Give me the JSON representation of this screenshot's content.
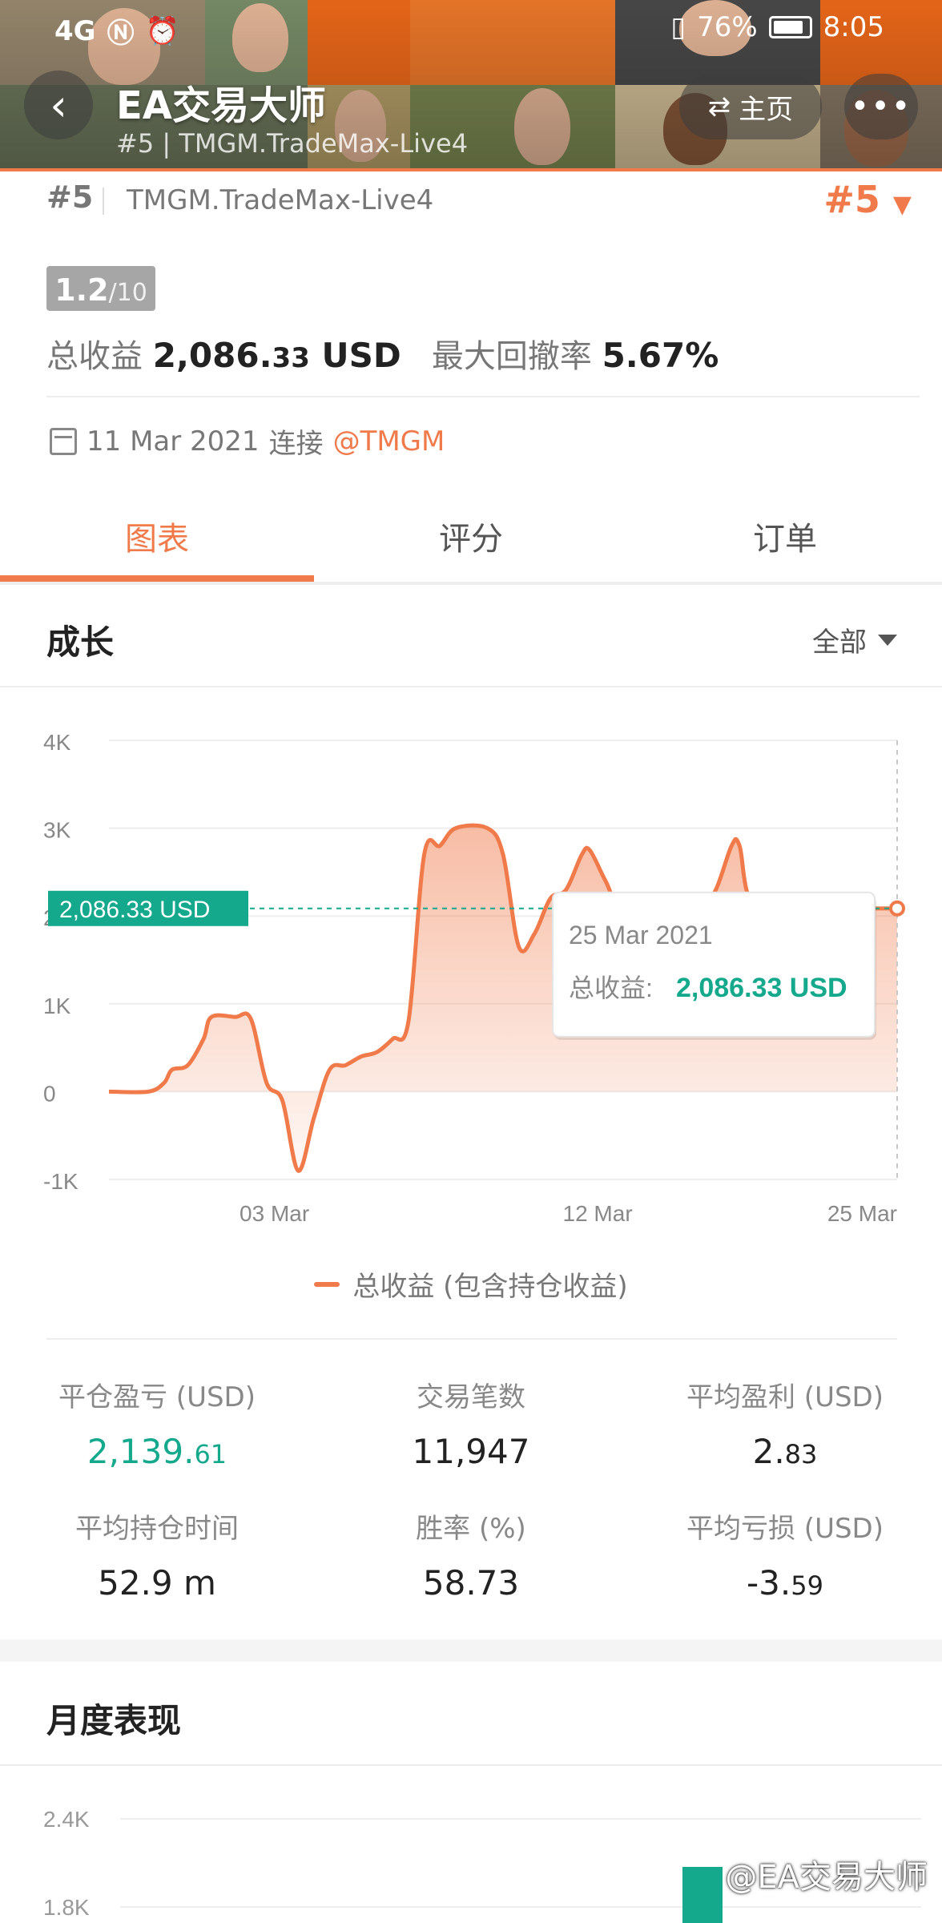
{
  "status_bar": {
    "signal": "4G",
    "battery_percent": "76%",
    "time": "8:05"
  },
  "header": {
    "title": "EA交易大师",
    "subtitle": "#5 | TMGM.TradeMax-Live4",
    "home_label": "主页",
    "more_icon": "ellipsis-icon",
    "back_icon": "chevron-left-icon"
  },
  "profile": {
    "rank_small": "#5",
    "server": "TMGM.TradeMax-Live4",
    "rank_big": "#5",
    "score": "1.2",
    "score_max": "/10",
    "total_profit_label": "总收益",
    "total_profit_main": "2,086.",
    "total_profit_dec": "33",
    "total_profit_unit": "USD",
    "drawdown_label": "最大回撤率",
    "drawdown_value": "5.67%",
    "connect_date": "11 Mar 2021",
    "connect_label": "连接",
    "connect_broker": "@TMGM"
  },
  "tabs": [
    {
      "label": "图表",
      "active": true
    },
    {
      "label": "评分",
      "active": false
    },
    {
      "label": "订单",
      "active": false
    }
  ],
  "growth": {
    "title": "成长",
    "filter_label": "全部",
    "current_value_label": "2,086.33 USD",
    "tooltip_date": "25 Mar 2021",
    "tooltip_label": "总收益:",
    "tooltip_value": "2,086.33 USD",
    "legend": "总收益 (包含持仓收益)"
  },
  "chart_data": {
    "type": "area",
    "x_tick_labels": [
      "03 Mar",
      "12 Mar",
      "25 Mar"
    ],
    "y_tick_labels": [
      "4K",
      "3K",
      "2K",
      "1K",
      "0",
      "-1K"
    ],
    "ylim": [
      -1000,
      4000
    ],
    "grid": true,
    "legend_placement": "bottom",
    "accent_color": "#f07a4a",
    "series": [
      {
        "name": "总收益 (包含持仓收益)",
        "points": [
          [
            0,
            0
          ],
          [
            0.05,
            0
          ],
          [
            0.07,
            100
          ],
          [
            0.08,
            250
          ],
          [
            0.1,
            300
          ],
          [
            0.12,
            600
          ],
          [
            0.13,
            850
          ],
          [
            0.16,
            850
          ],
          [
            0.18,
            830
          ],
          [
            0.2,
            100
          ],
          [
            0.22,
            -100
          ],
          [
            0.24,
            -900
          ],
          [
            0.26,
            -300
          ],
          [
            0.28,
            250
          ],
          [
            0.3,
            300
          ],
          [
            0.32,
            400
          ],
          [
            0.34,
            450
          ],
          [
            0.36,
            600
          ],
          [
            0.38,
            800
          ],
          [
            0.4,
            2700
          ],
          [
            0.42,
            2800
          ],
          [
            0.44,
            3000
          ],
          [
            0.48,
            3000
          ],
          [
            0.5,
            2700
          ],
          [
            0.52,
            1650
          ],
          [
            0.54,
            1800
          ],
          [
            0.56,
            2200
          ],
          [
            0.58,
            2300
          ],
          [
            0.6,
            2700
          ],
          [
            0.61,
            2750
          ],
          [
            0.63,
            2400
          ],
          [
            0.65,
            2100
          ],
          [
            0.7,
            2100
          ],
          [
            0.75,
            2100
          ],
          [
            0.77,
            2300
          ],
          [
            0.79,
            2800
          ],
          [
            0.8,
            2800
          ],
          [
            0.82,
            2100
          ],
          [
            0.9,
            2086
          ],
          [
            1.0,
            2086
          ]
        ]
      }
    ]
  },
  "stats": [
    {
      "label": "平仓盈亏 (USD)",
      "main": "2,139.",
      "dec": "61",
      "green": true
    },
    {
      "label": "交易笔数",
      "main": "11,947",
      "dec": "",
      "green": false
    },
    {
      "label": "平均盈利 (USD)",
      "main": "2.",
      "dec": "83",
      "green": false
    },
    {
      "label": "平均持仓时间",
      "main": "52.9 m",
      "dec": "",
      "green": false
    },
    {
      "label": "胜率 (%)",
      "main": "58.73",
      "dec": "",
      "green": false
    },
    {
      "label": "平均亏损 (USD)",
      "main": "-3.",
      "dec": "59",
      "green": false
    }
  ],
  "monthly": {
    "title": "月度表现",
    "y_tick_labels": [
      "2.4K",
      "1.8K"
    ]
  },
  "watermark": "@EA交易大师"
}
